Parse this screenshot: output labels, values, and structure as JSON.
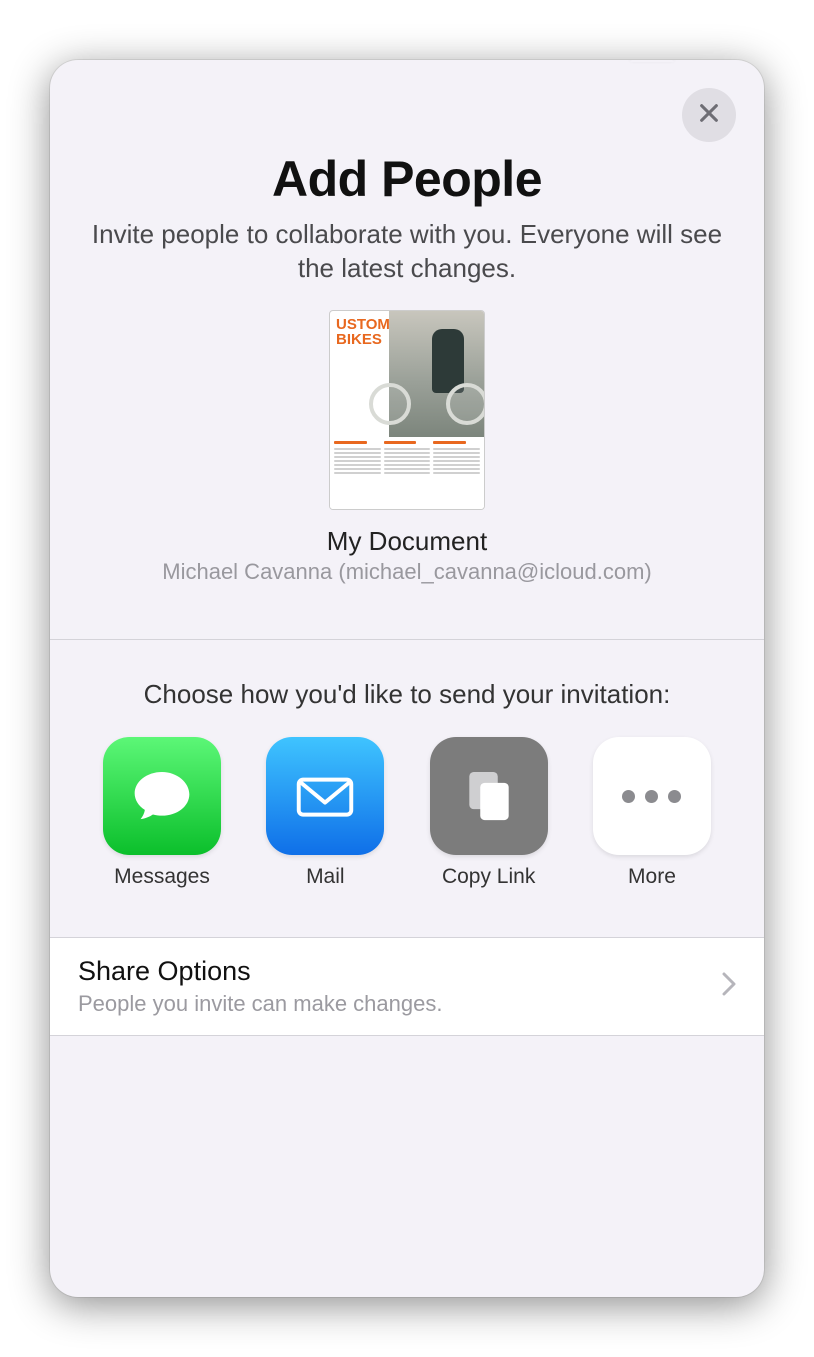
{
  "modal": {
    "title": "Add People",
    "subtitle": "Invite people to collaborate with you. Everyone will see the latest changes.",
    "document": {
      "name": "My Document",
      "owner": "Michael Cavanna (michael_cavanna@icloud.com)",
      "thumb_heading_line1": "USTOM",
      "thumb_heading_line2": "BIKES"
    },
    "choose_label": "Choose how you'd like to send your invitation:",
    "invite_options": {
      "messages": "Messages",
      "mail": "Mail",
      "copy_link": "Copy Link",
      "more": "More"
    },
    "share_options": {
      "title": "Share Options",
      "detail": "People you invite can make changes."
    }
  }
}
